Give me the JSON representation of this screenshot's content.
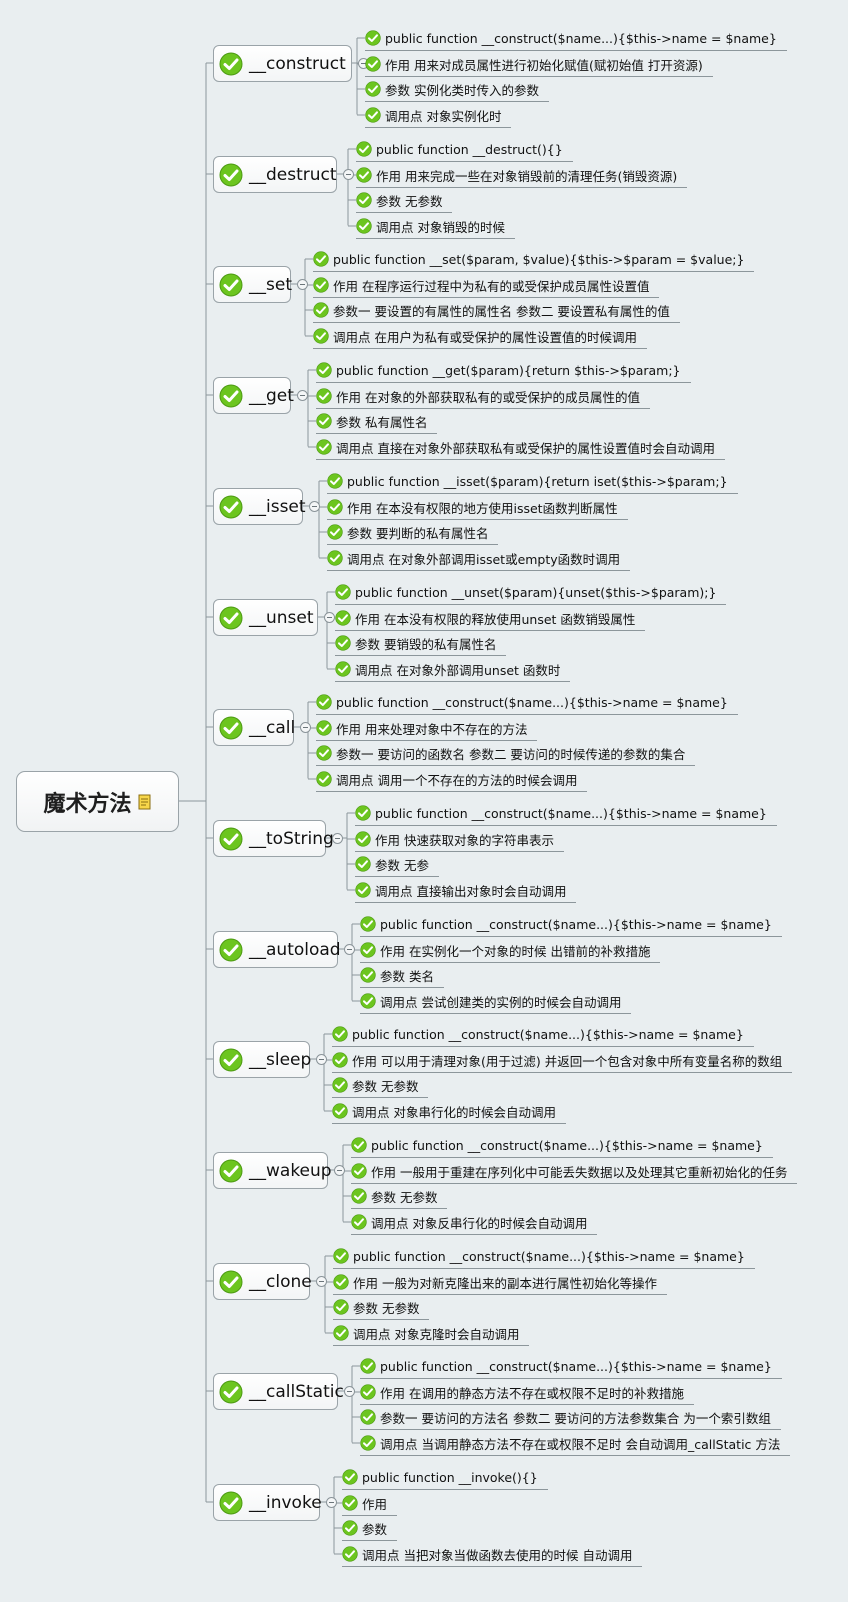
{
  "root": {
    "label": "魔术方法",
    "icon": "note-icon"
  },
  "colors": {
    "check_green": "#6cc51f",
    "line": "#8c969b",
    "background": "#e9eef0"
  },
  "branches": [
    {
      "label": "__construct",
      "items": [
        "public function __construct($name...){$this->name = $name}",
        "作用 用来对成员属性进行初始化赋值(赋初始值 打开资源)",
        "参数 实例化类时传入的参数",
        "调用点 对象实例化时"
      ]
    },
    {
      "label": "__destruct",
      "items": [
        "public function __destruct(){}",
        "作用 用来完成一些在对象销毁前的清理任务(销毁资源)",
        "参数 无参数",
        "调用点 对象销毁的时候"
      ]
    },
    {
      "label": "__set",
      "items": [
        "public function __set($param, $value){$this->$param = $value;}",
        "作用 在程序运行过程中为私有的或受保护成员属性设置值",
        "参数一 要设置的有属性的属性名 参数二 要设置私有属性的值",
        "调用点 在用户为私有或受保护的属性设置值的时候调用"
      ]
    },
    {
      "label": "__get",
      "items": [
        "public function __get($param){return $this->$param;}",
        "作用 在对象的外部获取私有的或受保护的成员属性的值",
        "参数 私有属性名",
        "调用点 直接在对象外部获取私有或受保护的属性设置值时会自动调用"
      ]
    },
    {
      "label": "__isset",
      "items": [
        "public function __isset($param){return iset($this->$param;}",
        "作用 在本没有权限的地方使用isset函数判断属性",
        "参数 要判断的私有属性名",
        "调用点 在对象外部调用isset或empty函数时调用"
      ]
    },
    {
      "label": "__unset",
      "items": [
        "public function __unset($param){unset($this->$param);}",
        "作用 在本没有权限的释放使用unset 函数销毁属性",
        "参数 要销毁的私有属性名",
        "调用点 在对象外部调用unset 函数时"
      ]
    },
    {
      "label": "__call",
      "items": [
        "public function __construct($name...){$this->name = $name}",
        "作用 用来处理对象中不存在的方法",
        "参数一 要访问的函数名 参数二 要访问的时候传递的参数的集合",
        "调用点 调用一个不存在的方法的时候会调用"
      ]
    },
    {
      "label": "__toString",
      "items": [
        "public function __construct($name...){$this->name = $name}",
        "作用 快速获取对象的字符串表示",
        "参数 无参",
        "调用点 直接输出对象时会自动调用"
      ]
    },
    {
      "label": "__autoload",
      "items": [
        "public function __construct($name...){$this->name = $name}",
        "作用 在实例化一个对象的时候 出错前的补救措施",
        "参数 类名",
        "调用点 尝试创建类的实例的时候会自动调用"
      ]
    },
    {
      "label": "__sleep",
      "items": [
        "public function __construct($name...){$this->name = $name}",
        "作用 可以用于清理对象(用于过滤) 并返回一个包含对象中所有变量名称的数组",
        "参数 无参数",
        "调用点 对象串行化的时候会自动调用"
      ]
    },
    {
      "label": "__wakeup",
      "items": [
        "public function __construct($name...){$this->name = $name}",
        "作用 一般用于重建在序列化中可能丢失数据以及处理其它重新初始化的任务",
        "参数 无参数",
        "调用点 对象反串行化的时候会自动调用"
      ]
    },
    {
      "label": "__clone",
      "items": [
        "public function __construct($name...){$this->name = $name}",
        "作用 一般为对新克隆出来的副本进行属性初始化等操作",
        "参数 无参数",
        "调用点 对象克隆时会自动调用"
      ]
    },
    {
      "label": "__callStatic",
      "items": [
        "public function __construct($name...){$this->name = $name}",
        "作用 在调用的静态方法不存在或权限不足时的补救措施",
        "参数一 要访问的方法名 参数二 要访问的方法参数集合 为一个索引数组",
        "调用点 当调用静态方法不存在或权限不足时 会自动调用_callStatic 方法"
      ]
    },
    {
      "label": "__invoke",
      "items": [
        "public function __invoke(){}",
        "作用",
        "参数",
        "调用点 当把对象当做函数去使用的时候 自动调用"
      ]
    }
  ]
}
